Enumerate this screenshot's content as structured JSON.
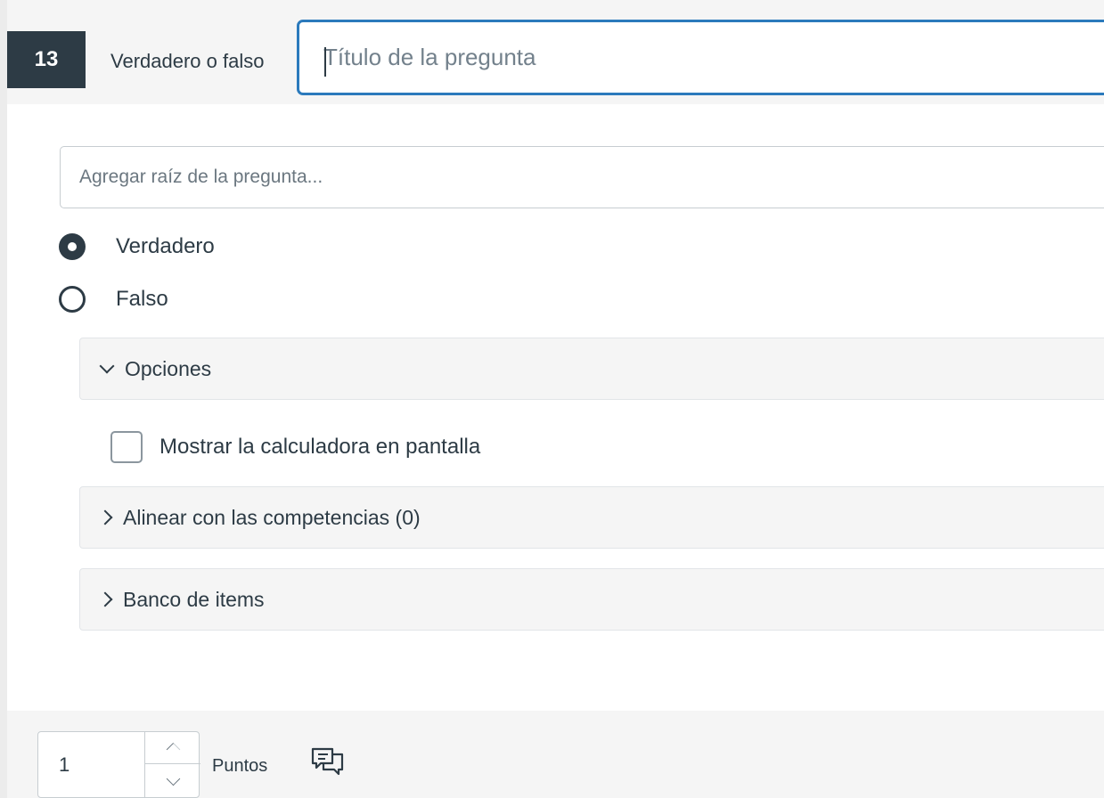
{
  "question": {
    "number": "13",
    "type_label": "Verdadero o falso",
    "title_placeholder": "Título de la pregunta",
    "title_value": "",
    "stem_placeholder": "Agregar raíz de la pregunta...",
    "stem_value": ""
  },
  "answers": [
    {
      "label": "Verdadero",
      "checked": true
    },
    {
      "label": "Falso",
      "checked": false
    }
  ],
  "options_panel": {
    "label": "Opciones",
    "expanded": true,
    "calculator_label": "Mostrar la calculadora en pantalla",
    "calculator_checked": false
  },
  "outcomes_panel": {
    "label": "Alinear con las competencias (0)",
    "expanded": false
  },
  "item_bank_panel": {
    "label": "Banco de items",
    "expanded": false
  },
  "points": {
    "value": "1",
    "label": "Puntos"
  },
  "icons": {
    "options_chevron": "chevron-down-icon",
    "outcomes_chevron": "chevron-right-icon",
    "item_bank_chevron": "chevron-right-icon",
    "stepper_up": "chevron-up-icon",
    "stepper_down": "chevron-down-icon",
    "feedback": "comment-icon"
  },
  "colors": {
    "accent_focus": "#2b7abc",
    "number_badge": "#2d3b45",
    "text": "#2d3b45"
  }
}
